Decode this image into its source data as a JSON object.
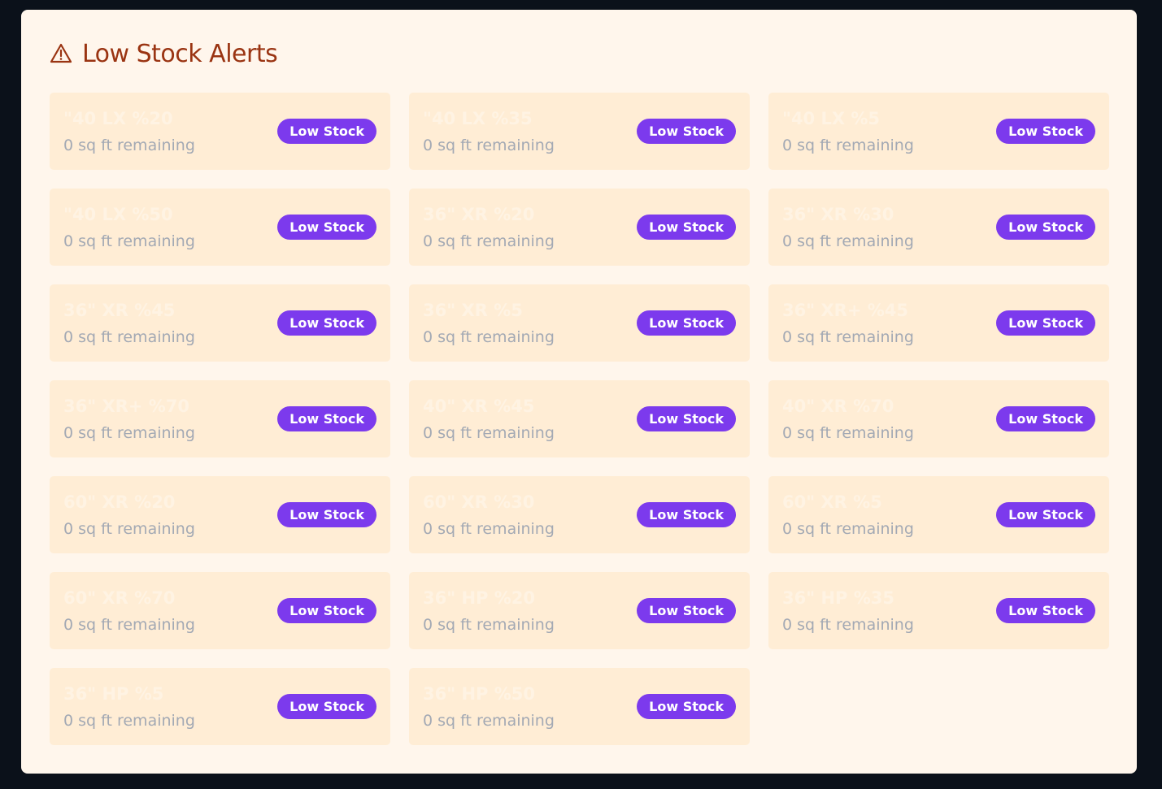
{
  "panel": {
    "title": "Low Stock Alerts",
    "icon": "warning-triangle-icon",
    "colors": {
      "title": "#9a3412",
      "card_background": "#ffedd5",
      "badge": "#7c3aed"
    }
  },
  "alerts": [
    {
      "name": "\"40 LX %20",
      "remaining": "0 sq ft remaining",
      "status": "Low Stock"
    },
    {
      "name": "\"40 LX %35",
      "remaining": "0 sq ft remaining",
      "status": "Low Stock"
    },
    {
      "name": "\"40 LX %5",
      "remaining": "0 sq ft remaining",
      "status": "Low Stock"
    },
    {
      "name": "\"40 LX %50",
      "remaining": "0 sq ft remaining",
      "status": "Low Stock"
    },
    {
      "name": "36\" XR %20",
      "remaining": "0 sq ft remaining",
      "status": "Low Stock"
    },
    {
      "name": "36\" XR %30",
      "remaining": "0 sq ft remaining",
      "status": "Low Stock"
    },
    {
      "name": "36\" XR %45",
      "remaining": "0 sq ft remaining",
      "status": "Low Stock"
    },
    {
      "name": "36\" XR %5",
      "remaining": "0 sq ft remaining",
      "status": "Low Stock"
    },
    {
      "name": "36\" XR+ %45",
      "remaining": "0 sq ft remaining",
      "status": "Low Stock"
    },
    {
      "name": "36\" XR+ %70",
      "remaining": "0 sq ft remaining",
      "status": "Low Stock"
    },
    {
      "name": "40\" XR %45",
      "remaining": "0 sq ft remaining",
      "status": "Low Stock"
    },
    {
      "name": "40\" XR %70",
      "remaining": "0 sq ft remaining",
      "status": "Low Stock"
    },
    {
      "name": "60\" XR %20",
      "remaining": "0 sq ft remaining",
      "status": "Low Stock"
    },
    {
      "name": "60\" XR %30",
      "remaining": "0 sq ft remaining",
      "status": "Low Stock"
    },
    {
      "name": "60\" XR %5",
      "remaining": "0 sq ft remaining",
      "status": "Low Stock"
    },
    {
      "name": "60\" XR %70",
      "remaining": "0 sq ft remaining",
      "status": "Low Stock"
    },
    {
      "name": "36\" HP %20",
      "remaining": "0 sq ft remaining",
      "status": "Low Stock"
    },
    {
      "name": "36\" HP %35",
      "remaining": "0 sq ft remaining",
      "status": "Low Stock"
    },
    {
      "name": "36\" HP %5",
      "remaining": "0 sq ft remaining",
      "status": "Low Stock"
    },
    {
      "name": "36\" HP %50",
      "remaining": "0 sq ft remaining",
      "status": "Low Stock"
    }
  ]
}
